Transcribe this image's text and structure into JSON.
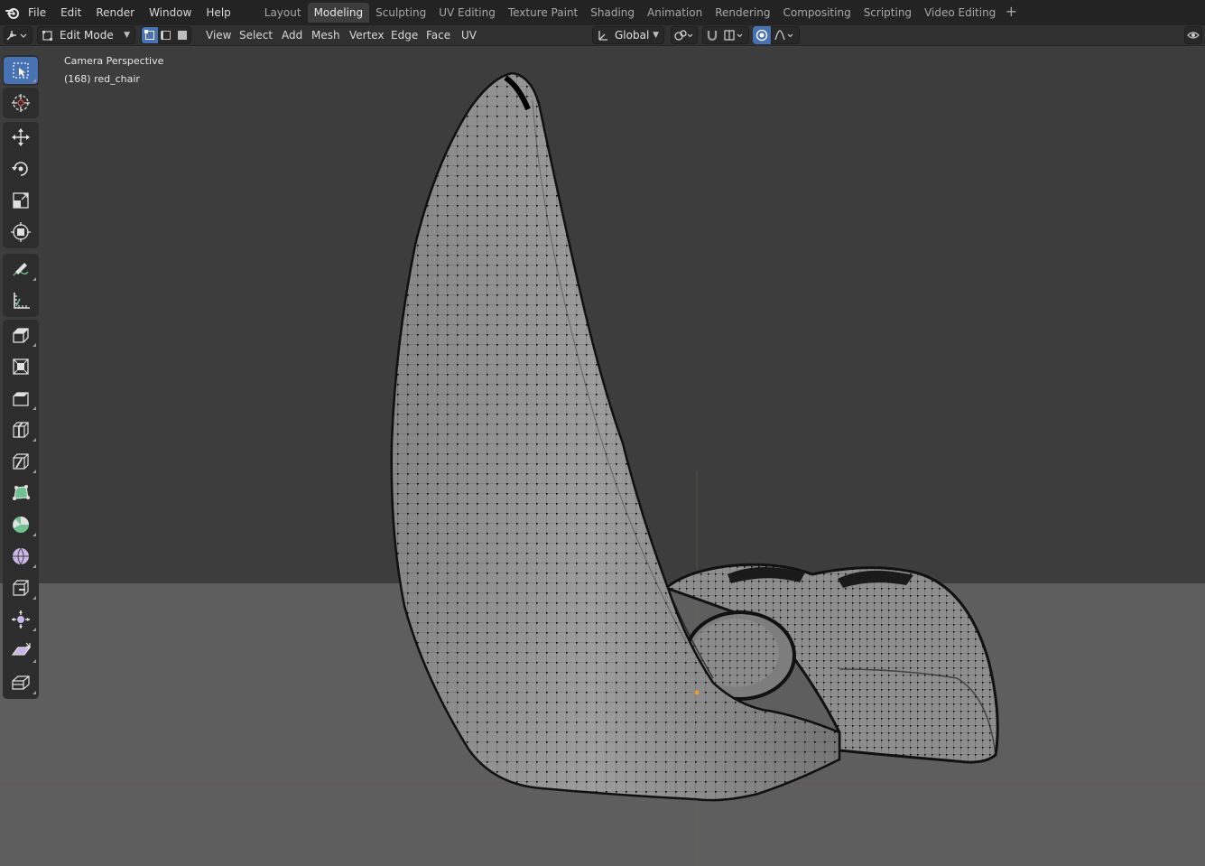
{
  "menubar": {
    "items": [
      "File",
      "Edit",
      "Render",
      "Window",
      "Help"
    ],
    "workspaces": [
      "Layout",
      "Modeling",
      "Sculpting",
      "UV Editing",
      "Texture Paint",
      "Shading",
      "Animation",
      "Rendering",
      "Compositing",
      "Scripting",
      "Video Editing"
    ],
    "active_workspace": "Modeling",
    "add_workspace": "+"
  },
  "header": {
    "mode": "Edit Mode",
    "menus": [
      "View",
      "Select",
      "Add",
      "Mesh",
      "Vertex",
      "Edge",
      "Face",
      "UV"
    ],
    "transform_orientation": "Global"
  },
  "viewport": {
    "view_name": "Camera Perspective",
    "object_info": "(168) red_chair"
  },
  "toolbar": {
    "tools": [
      "select-box",
      "cursor",
      "move",
      "rotate",
      "scale",
      "transform",
      "annotate",
      "measure",
      "extrude-region",
      "inset-faces",
      "bevel",
      "loop-cut",
      "knife",
      "poly-build",
      "spin",
      "smooth",
      "edge-slide",
      "shrink-fatten",
      "shear",
      "rip-region"
    ]
  },
  "colors": {
    "accent": "#4772b3",
    "topbar": "#232323",
    "header": "#303030",
    "viewport_top": "#3d3d3d",
    "floor": "#5e5e5e",
    "mesh_face": "#9d9d9d"
  }
}
